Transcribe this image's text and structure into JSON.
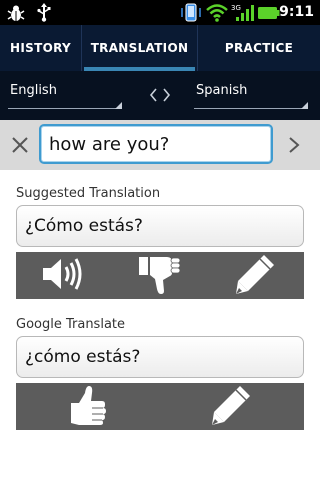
{
  "status_bar": {
    "time": "9:11",
    "icons": [
      "bug-icon",
      "usb-icon",
      "vibrate-icon",
      "wifi-icon",
      "signal-3g-icon",
      "battery-icon"
    ]
  },
  "tabs": [
    {
      "label": "HISTORY",
      "active": false
    },
    {
      "label": "TRANSLATION",
      "active": true
    },
    {
      "label": "PRACTICE",
      "active": false
    }
  ],
  "languages": {
    "from": "English",
    "to": "Spanish",
    "swap_glyph": "<>"
  },
  "search": {
    "value": "how are you?"
  },
  "suggested": {
    "label": "Suggested Translation",
    "text": "¿Cómo estás?",
    "actions": [
      "speaker-icon",
      "thumbs-down-icon",
      "pencil-icon"
    ]
  },
  "google": {
    "label": "Google Translate",
    "text": "¿cómo estás?",
    "actions": [
      "thumbs-up-icon",
      "pencil-icon"
    ]
  },
  "colors": {
    "tab_bar": "#0a1a33",
    "lang_row": "#071120",
    "tab_indicator": "#3a86b4",
    "input_border": "#3f9bd0",
    "action_bar": "#5c5c5c"
  }
}
